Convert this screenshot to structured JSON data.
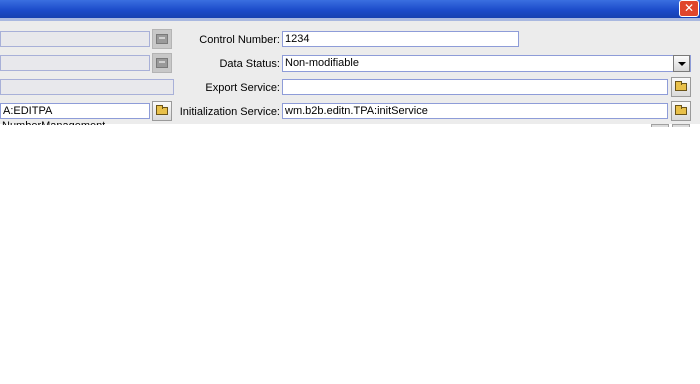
{
  "window": {
    "close_glyph": "✕"
  },
  "left": {
    "row4_value": "A:EDITPA",
    "overflow_text": "NumberManagement"
  },
  "right": {
    "control_number": {
      "label": "Control Number:",
      "value": "1234"
    },
    "data_status": {
      "label": "Data Status:",
      "value": "Non-modifiable"
    },
    "export_service": {
      "label": "Export Service:",
      "value": ""
    },
    "init_service": {
      "label": "Initialization Service:",
      "value": "wm.b2b.editn.TPA:initService"
    }
  },
  "icons": {
    "browse": "folder-icon",
    "disabled_browse": "disabled-browse-icon",
    "dropdown": "chevron-down-icon"
  }
}
